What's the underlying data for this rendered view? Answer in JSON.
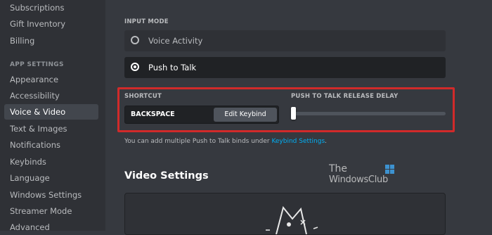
{
  "sidebar": {
    "items_top": [
      "Subscriptions",
      "Gift Inventory",
      "Billing"
    ],
    "section_header": "APP SETTINGS",
    "items": [
      "Appearance",
      "Accessibility",
      "Voice & Video",
      "Text & Images",
      "Notifications",
      "Keybinds",
      "Language",
      "Windows Settings",
      "Streamer Mode",
      "Advanced"
    ],
    "active_item": "Voice & Video"
  },
  "input_mode": {
    "label": "INPUT MODE",
    "options": [
      {
        "label": "Voice Activity",
        "selected": false
      },
      {
        "label": "Push to Talk",
        "selected": true
      }
    ]
  },
  "shortcut": {
    "label": "SHORTCUT",
    "value": "BACKSPACE",
    "edit_button": "Edit Keybind"
  },
  "release_delay": {
    "label": "PUSH TO TALK RELEASE DELAY",
    "fraction": 0.0
  },
  "hint": {
    "text": "You can add multiple Push to Talk binds under ",
    "link": "Keybind Settings",
    "suffix": "."
  },
  "video_settings": {
    "title": "Video Settings"
  },
  "watermark": {
    "line1": "The",
    "line2": "WindowsClub"
  },
  "colors": {
    "background": "#36393f",
    "sidebar": "#2f3136",
    "highlight": "#d12a2a",
    "link": "#00aff4"
  }
}
